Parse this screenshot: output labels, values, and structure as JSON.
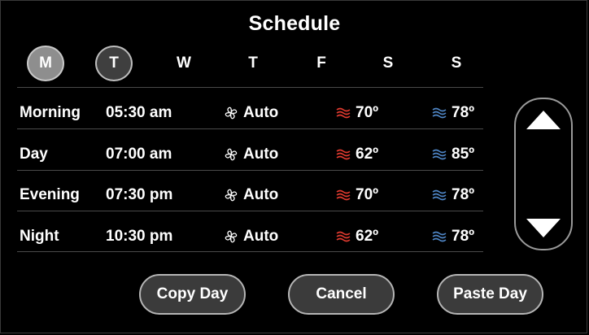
{
  "title": "Schedule",
  "days": [
    {
      "label": "M",
      "selected": true
    },
    {
      "label": "T",
      "selected": true
    },
    {
      "label": "W",
      "selected": false
    },
    {
      "label": "T",
      "selected": false
    },
    {
      "label": "F",
      "selected": false
    },
    {
      "label": "S",
      "selected": false
    },
    {
      "label": "S",
      "selected": false
    }
  ],
  "rows": [
    {
      "period": "Morning",
      "time": "05:30 am",
      "fan": "Auto",
      "heat": "70º",
      "cool": "78º"
    },
    {
      "period": "Day",
      "time": "07:00 am",
      "fan": "Auto",
      "heat": "62º",
      "cool": "85º"
    },
    {
      "period": "Evening",
      "time": "07:30 pm",
      "fan": "Auto",
      "heat": "70º",
      "cool": "78º"
    },
    {
      "period": "Night",
      "time": "10:30 pm",
      "fan": "Auto",
      "heat": "62º",
      "cool": "78º"
    }
  ],
  "buttons": {
    "copy": "Copy Day",
    "cancel": "Cancel",
    "paste": "Paste Day"
  },
  "icons": {
    "fan": "fan-icon",
    "heat": "heat-waves-icon",
    "cool": "cool-waves-icon",
    "up": "arrow-up-icon",
    "down": "arrow-down-icon"
  },
  "colors": {
    "heat": "#e03a2f",
    "cool": "#4f86c6",
    "selected_day": "#8e8e8e",
    "secondary_day": "#3f3f3f"
  }
}
